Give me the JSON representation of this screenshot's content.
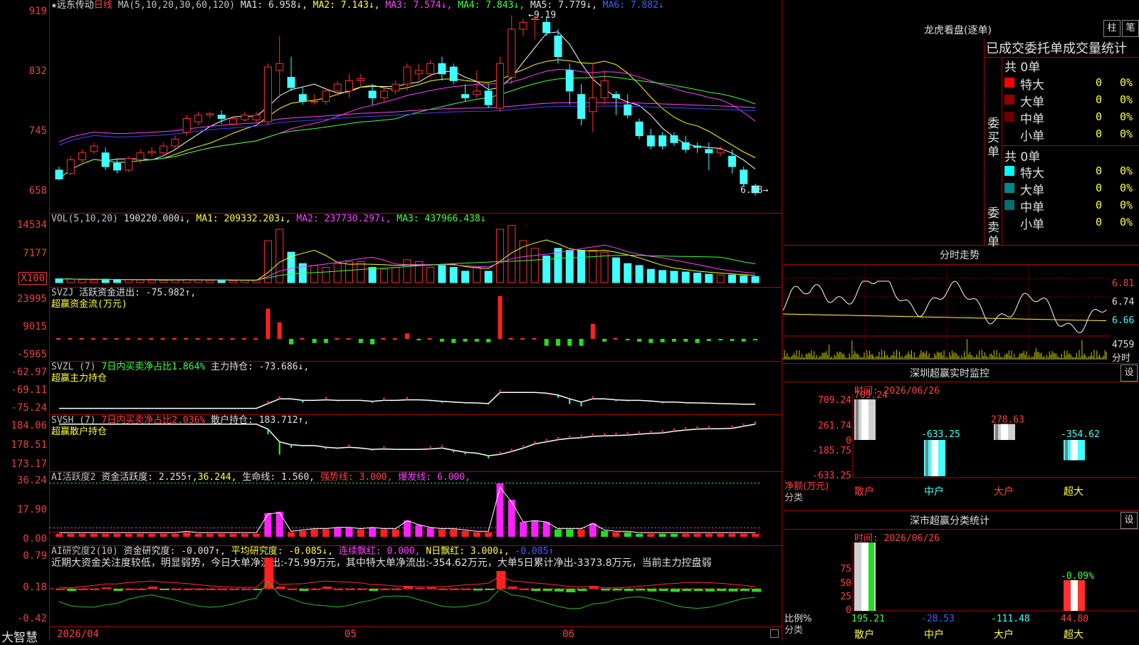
{
  "kline": {
    "star": "★",
    "name": "远东传动",
    "period": "日线",
    "ma_header": "MA(5,10,20,30,60,120)",
    "ma1": "MA1: 6.958↓,",
    "ma2": "MA2: 7.143↓,",
    "ma3": "MA3: 7.574↓,",
    "ma4": "MA4: 7.843↓,",
    "ma5": "MA5: 7.779↓,",
    "ma6": "MA6: 7.882↓",
    "y_ticks": [
      "919",
      "832",
      "745",
      "658"
    ],
    "high_label": "9.19",
    "low_label": "6.58",
    "candles": [
      [
        6.95,
        6.82,
        7.0,
        6.8
      ],
      [
        6.9,
        7.1,
        7.15,
        6.88
      ],
      [
        7.1,
        7.2,
        7.25,
        7.05
      ],
      [
        7.22,
        7.3,
        7.35,
        7.18
      ],
      [
        7.2,
        7.0,
        7.28,
        6.95
      ],
      [
        7.05,
        6.95,
        7.1,
        6.9
      ],
      [
        6.95,
        7.12,
        7.15,
        6.92
      ],
      [
        7.1,
        7.2,
        7.25,
        7.05
      ],
      [
        7.2,
        7.22,
        7.28,
        7.15
      ],
      [
        7.2,
        7.3,
        7.35,
        7.15
      ],
      [
        7.3,
        7.4,
        7.45,
        7.25
      ],
      [
        7.5,
        7.7,
        7.75,
        7.45
      ],
      [
        7.65,
        7.75,
        7.8,
        7.6
      ],
      [
        7.75,
        7.77,
        7.8,
        7.7
      ],
      [
        7.75,
        7.7,
        7.82,
        7.62
      ],
      [
        7.62,
        7.7,
        7.72,
        7.6
      ],
      [
        7.68,
        7.75,
        7.8,
        7.65
      ],
      [
        7.68,
        7.75,
        7.8,
        7.65
      ],
      [
        7.65,
        8.45,
        8.5,
        7.6
      ],
      [
        8.4,
        8.5,
        8.9,
        8.0
      ],
      [
        8.3,
        8.15,
        8.6,
        8.1
      ],
      [
        8.05,
        7.95,
        8.15,
        7.9
      ],
      [
        7.95,
        7.95,
        8.05,
        7.9
      ],
      [
        7.95,
        8.1,
        8.15,
        7.9
      ],
      [
        8.1,
        8.2,
        8.25,
        8.05
      ],
      [
        8.1,
        8.25,
        8.35,
        8.0
      ],
      [
        8.25,
        8.28,
        8.35,
        8.15
      ],
      [
        8.1,
        8.0,
        8.2,
        7.9
      ],
      [
        8.0,
        8.1,
        8.15,
        7.95
      ],
      [
        8.1,
        8.2,
        8.25,
        8.05
      ],
      [
        8.2,
        8.45,
        8.5,
        8.1
      ],
      [
        8.35,
        8.4,
        8.5,
        8.25
      ],
      [
        8.35,
        8.5,
        8.55,
        8.3
      ],
      [
        8.5,
        8.35,
        8.6,
        8.25
      ],
      [
        8.45,
        8.25,
        8.5,
        8.2
      ],
      [
        8.05,
        8.0,
        8.2,
        7.95
      ],
      [
        8.05,
        8.1,
        8.4,
        8.0
      ],
      [
        8.1,
        7.9,
        8.2,
        7.85
      ],
      [
        7.85,
        8.5,
        8.6,
        7.8
      ],
      [
        8.3,
        9.0,
        9.2,
        8.2
      ],
      [
        9.0,
        9.1,
        9.15,
        8.9
      ],
      [
        9.15,
        9.15,
        9.19,
        8.85
      ],
      [
        9.1,
        8.95,
        9.19,
        8.9
      ],
      [
        8.9,
        8.6,
        9.0,
        8.5
      ],
      [
        8.4,
        8.1,
        8.5,
        7.9
      ],
      [
        8.05,
        7.7,
        8.2,
        7.6
      ],
      [
        7.8,
        8.0,
        8.5,
        7.5
      ],
      [
        8.0,
        8.25,
        8.4,
        7.9
      ],
      [
        8.05,
        8.0,
        8.1,
        7.75
      ],
      [
        7.9,
        7.75,
        8.05,
        7.7
      ],
      [
        7.65,
        7.45,
        7.7,
        7.4
      ],
      [
        7.45,
        7.3,
        7.55,
        7.25
      ],
      [
        7.45,
        7.3,
        7.5,
        7.25
      ],
      [
        7.45,
        7.35,
        7.5,
        7.3
      ],
      [
        7.35,
        7.25,
        7.45,
        7.2
      ],
      [
        7.3,
        7.28,
        7.35,
        7.2
      ],
      [
        7.25,
        7.2,
        7.35,
        6.95
      ],
      [
        7.2,
        7.25,
        7.3,
        7.15
      ],
      [
        7.15,
        7.0,
        7.25,
        6.9
      ],
      [
        6.95,
        6.75,
        7.0,
        6.72
      ],
      [
        6.72,
        6.62,
        6.75,
        6.58
      ]
    ],
    "ma_colors": [
      "#ffffff",
      "#ffff00",
      "#ff40ff",
      "#40ff40",
      "#4040ff",
      "#ff40ff"
    ],
    "bull_color": "#ff3030",
    "bear_color": "#40ffff"
  },
  "vol": {
    "header": "VOL(5,10,20)",
    "v": "190220.000↓,",
    "ma1": "MA1: 209332.203↓,",
    "ma2": "MA2: 237730.297↓,",
    "ma3": "MA3: 437966.438↓",
    "y_ticks": [
      "14534",
      "7177"
    ],
    "unit": "X100",
    "values": [
      1000,
      900,
      800,
      700,
      900,
      700,
      750,
      700,
      650,
      600,
      700,
      800,
      700,
      600,
      600,
      500,
      600,
      600,
      11000,
      14000,
      8000,
      5000,
      4500,
      4000,
      5000,
      5500,
      5500,
      4000,
      3500,
      4000,
      6000,
      5500,
      4000,
      4500,
      4000,
      3000,
      4000,
      3000,
      14000,
      15000,
      11000,
      9000,
      7000,
      9000,
      8500,
      8500,
      8500,
      8000,
      6500,
      5000,
      4500,
      3500,
      3200,
      3000,
      2800,
      2500,
      2200,
      2000,
      2000,
      1800,
      1600
    ]
  },
  "svzj": {
    "name": "SVZJ",
    "label": "活跃资金进出: -75.982↑,",
    "sub": "超赢资金流(万元)",
    "y_ticks": [
      "23995",
      "9015",
      "-5965"
    ],
    "values": [
      0,
      0,
      0,
      0,
      0,
      0,
      0,
      0,
      0,
      0,
      0,
      0,
      0,
      0,
      0,
      0,
      0,
      0,
      22000,
      12000,
      -4000,
      0,
      -3000,
      -3000,
      0,
      0,
      -3000,
      -4000,
      0,
      0,
      4000,
      -1000,
      0,
      -2000,
      -3000,
      -2000,
      -2000,
      -2500,
      31000,
      0,
      0,
      0,
      -5000,
      -5000,
      -5000,
      -5000,
      11000,
      -2000,
      0,
      -1000,
      -2000,
      -3000,
      -2500,
      -2000,
      -2000,
      -3000,
      -1500,
      -1000,
      -1500,
      -2000,
      -1000
    ]
  },
  "svzl": {
    "name": "SVZL",
    "period": "(7)",
    "pct": "7日内买卖净占比1.864%",
    "label": "主力持仓: -73.686↓,",
    "sub": "超赢主力持仓",
    "y_ticks": [
      "-62.97",
      "-69.11",
      "-75.24"
    ],
    "values": [
      -75.0,
      -75.0,
      -75.0,
      -75.0,
      -75.0,
      -75.0,
      -75.0,
      -75.0,
      -75.0,
      -75.0,
      -75.0,
      -75.0,
      -75.0,
      -75.0,
      -75.0,
      -75.0,
      -75.0,
      -75.0,
      -73.5,
      -72.0,
      -72.0,
      -72.5,
      -72.5,
      -72.3,
      -72.5,
      -72.5,
      -72.5,
      -72.8,
      -72.5,
      -72.5,
      -72.3,
      -72.3,
      -72.5,
      -72.8,
      -73.0,
      -73.2,
      -73.3,
      -73.5,
      -70.0,
      -70.0,
      -70.0,
      -70.0,
      -70.2,
      -70.8,
      -72.0,
      -73.0,
      -72.0,
      -72.0,
      -72.3,
      -72.5,
      -72.5,
      -72.7,
      -73.0,
      -73.0,
      -73.2,
      -73.3,
      -73.4,
      -73.5,
      -73.6,
      -73.7,
      -73.7
    ]
  },
  "svsh": {
    "name": "SVSH",
    "period": "(7)",
    "pct": "7日内买卖净占比2.036%",
    "label": "散户持仓: 183.712↑,",
    "sub": "超赢散户持仓",
    "y_ticks": [
      "184.06",
      "178.51",
      "173.17"
    ],
    "values": [
      183.7,
      183.7,
      183.7,
      183.7,
      183.7,
      183.7,
      183.7,
      183.7,
      183.7,
      183.7,
      183.7,
      183.7,
      183.7,
      183.7,
      183.7,
      183.7,
      183.7,
      183.7,
      182.5,
      179.5,
      178.8,
      178.6,
      178.6,
      178.2,
      178.0,
      178.2,
      178.0,
      177.7,
      177.8,
      177.7,
      177.7,
      177.7,
      177.8,
      178.0,
      177.5,
      177.0,
      176.8,
      176.2,
      176.5,
      177.2,
      178.0,
      179.0,
      179.5,
      180.0,
      180.3,
      180.5,
      180.8,
      180.9,
      181.0,
      181.1,
      181.3,
      181.5,
      181.6,
      182.0,
      182.3,
      182.5,
      182.6,
      182.6,
      182.7,
      183.2,
      183.7
    ]
  },
  "ai1": {
    "name": "AI活跃度2",
    "label": "资金活跃度: 2.255↑,",
    "v2": "36.244,",
    "life": "生命线: 1.560,",
    "strong": "强势线: 3.000,",
    "burst": "爆发线: 6.000,",
    "y_ticks": [
      "36.24",
      "17.90",
      "0.00"
    ],
    "values": [
      2,
      2,
      2,
      2,
      2,
      2,
      2,
      2,
      2,
      2,
      2,
      3,
      2,
      2,
      2,
      2,
      2,
      2,
      16,
      17,
      3,
      4,
      5,
      5,
      6,
      6,
      5,
      6,
      5,
      5,
      11,
      8,
      6,
      5,
      5,
      4,
      3,
      3,
      36,
      25,
      10,
      11,
      10,
      5,
      5,
      5,
      9,
      4,
      3,
      3,
      2,
      2,
      2,
      2,
      2,
      2,
      2,
      2,
      2,
      2,
      2
    ]
  },
  "ai2": {
    "name": "AI研究度2(10)",
    "label": "资金研究度: -0.007↑,",
    "avg": "平均研究度: -0.085↓,",
    "lh": "连续飘红: 0.000,",
    "nh": "N日飘红: 3.000↓,",
    "last": "-0.085↑",
    "summary": "近期大资金关注度较低，明显弱势，今日大单净流出:-75.99万元，其中特大单净流出:-354.62万元，大单5日累计净出-3373.8万元，当前主力控盘弱",
    "y_ticks": [
      "0.79",
      "0.18",
      "-0.42"
    ],
    "values": [
      0,
      -0.05,
      0,
      0,
      0.03,
      -0.05,
      0,
      0,
      0.05,
      -0.02,
      0,
      0,
      0,
      0,
      0,
      0,
      0,
      -0.02,
      0.7,
      0.05,
      0,
      -0.05,
      0,
      0.05,
      0,
      0,
      0,
      -0.05,
      0,
      0,
      0.05,
      0.02,
      0.03,
      0,
      0,
      0,
      -0.04,
      -0.03,
      0.4,
      0.05,
      0,
      -0.05,
      -0.05,
      -0.06,
      -0.08,
      -0.05,
      0.06,
      -0.04,
      -0.04,
      -0.05,
      -0.04,
      -0.06,
      -0.05,
      -0.07,
      -0.05,
      -0.05,
      -0.06,
      -0.05,
      -0.06,
      -0.05,
      -0.07
    ]
  },
  "bottom": {
    "brand": "大智慧",
    "date_start": "2026/04",
    "month2": "05",
    "month3": "06"
  },
  "lhb": {
    "title": "龙虎看盘(逐单)",
    "btn1": "柱",
    "btn2": "笔",
    "sub": "已成交委托单成交量统计",
    "buy": {
      "side": "委买单",
      "count": "共 0单",
      "rows": [
        {
          "name": "特大",
          "val": "0",
          "pct": "0%",
          "color": "#ff0000"
        },
        {
          "name": "大单",
          "val": "0",
          "pct": "0%",
          "color": "#900000"
        },
        {
          "name": "中单",
          "val": "0",
          "pct": "0%",
          "color": "#700000"
        },
        {
          "name": "小单",
          "val": "0",
          "pct": "0%",
          "color": "#000000"
        }
      ]
    },
    "sell": {
      "side": "委卖单",
      "count": "共 0单",
      "rows": [
        {
          "name": "特大",
          "val": "0",
          "pct": "0%",
          "color": "#00ffff"
        },
        {
          "name": "大单",
          "val": "0",
          "pct": "0%",
          "color": "#008888"
        },
        {
          "name": "中单",
          "val": "0",
          "pct": "0%",
          "color": "#007070"
        },
        {
          "name": "小单",
          "val": "0",
          "pct": "0%",
          "color": "#000000"
        }
      ]
    }
  },
  "minute": {
    "title": "分时走势",
    "y_ticks": [
      "6.81",
      "6.74",
      "6.66"
    ],
    "vol_label": "4759",
    "vol_unit": "分时"
  },
  "sz_monitor": {
    "title": "深圳超赢实时监控",
    "btn": "设",
    "time": "时间: 2026/06/26",
    "y_ticks": [
      "709.24",
      "261.74",
      "0",
      "-185.75",
      "-633.25"
    ],
    "ylabel": "净额(万元)",
    "xlabel": "分类",
    "bars": [
      {
        "cat": "散户",
        "value": 709.24,
        "label": "709.24",
        "cat_color": "#ff4040",
        "lbl_color": "#ff4040"
      },
      {
        "cat": "中户",
        "value": -633.25,
        "label": "-633.25",
        "cat_color": "#40ffff",
        "lbl_color": "#40ffff"
      },
      {
        "cat": "大户",
        "value": 278.63,
        "label": "278.63",
        "cat_color": "#ff4040",
        "lbl_color": "#ff4040"
      },
      {
        "cat": "超大",
        "value": -354.62,
        "label": "-354.62",
        "cat_color": "#ffff40",
        "lbl_color": "#40ffff"
      }
    ]
  },
  "sz_class": {
    "title": "深市超赢分类统计",
    "btn": "设",
    "time": "时间: 2026/06/26",
    "y_ticks": [
      "75",
      "50",
      "25",
      "0"
    ],
    "ylabel": "比例%",
    "xlabel": "分类",
    "bars": [
      {
        "cat": "散户",
        "pct": 100,
        "label": "195.21",
        "cat_color": "#ffff40",
        "lbl_color": "#40ff40"
      },
      {
        "cat": "中户",
        "pct": 0,
        "label": "-28.53",
        "cat_color": "#ffff40",
        "lbl_color": "#4060ff"
      },
      {
        "cat": "大户",
        "pct": 0,
        "label": "-111.48",
        "cat_color": "#ffff40",
        "lbl_color": "#40ffff"
      },
      {
        "cat": "超大",
        "pct": 44.8,
        "label": "44.80",
        "top": "-0.09%",
        "cat_color": "#ffff40",
        "lbl_color": "#ff4040"
      }
    ]
  }
}
